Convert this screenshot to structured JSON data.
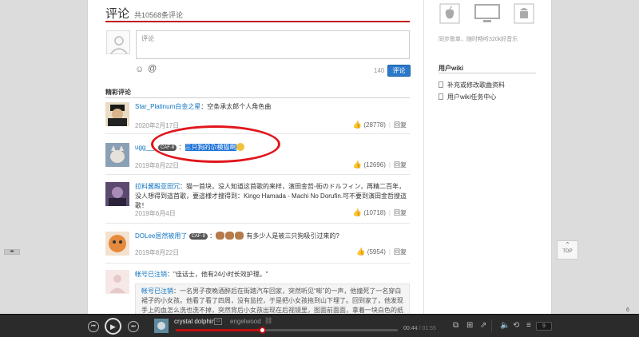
{
  "comments_header": {
    "title": "评论",
    "count": "共10568条评论"
  },
  "compose": {
    "placeholder": "评论",
    "char_count": "140",
    "submit_label": "评论",
    "emoji_icon": "smiley-icon",
    "at_icon": "at-icon"
  },
  "section": {
    "title": "精彩评论"
  },
  "comments": [
    {
      "user": "Star_Platinum白金之星",
      "text": "空条承太郎个人角色曲",
      "time": "2020年2月17日",
      "likes": "(28778)",
      "reply": "回复"
    },
    {
      "user": "ugg___",
      "badge": "CAF·8",
      "highlight": "三只狗的尕模猫啊",
      "time": "2019年8月22日",
      "likes": "(12696)",
      "reply": "回复"
    },
    {
      "user": "拉料酱殿亚田冗",
      "text": "猫一首块，没人知道这首歌的来样，演田金哲-街のドルフィン，再精二百年，没人想得到這首歌，要這様才搜得到：Kingo Hamada - Machi No Dorufin.可不要到演田金哲搜這歌！",
      "time": "2019年6月4日",
      "likes": "(10718)",
      "reply": "回复"
    },
    {
      "user": "DOLee居然被用了",
      "badge": "CAF·8",
      "text": "有多少人是被三只狗吸引过来的?",
      "time": "2019年8月22日",
      "likes": "(5954)",
      "reply": "回复"
    },
    {
      "user": "帐号已注销",
      "text": "\"佳话士，他有24小时长效护理。\"",
      "quote_user": "帐号已注销",
      "quote_text": "一名男子夜晚酒醉后在街踏汽车回家，突然听见“嘭”的一声，他撞死了一名穿白裙子的小女孩。他看了看了四周，没有监控，于是把小女孩拖到山下埋了。回到家了，他发现手上的血怎么洗也洗不掉，突然背后小女孩出现在后视镜里，图面前面面，拿着一块白色的纸巾，遇出小满鲜血的手"
    }
  ],
  "sidebar": {
    "download_icons": [
      "apple-icon",
      "desktop-icon",
      "android-icon"
    ],
    "download_text": "同步歌单，随时畅听320k好音乐",
    "wiki_title": "用户wiki",
    "wiki_items": [
      "补充或修改歌曲资料",
      "用户wiki任务中心"
    ]
  },
  "top_button": "TOP",
  "player": {
    "song": "crystal dolphin",
    "artist": "engelwood",
    "time_current": "00:44",
    "time_total": "/ 01:55",
    "progress": 0.39,
    "playlist_count": "9"
  },
  "corner_number": "6"
}
